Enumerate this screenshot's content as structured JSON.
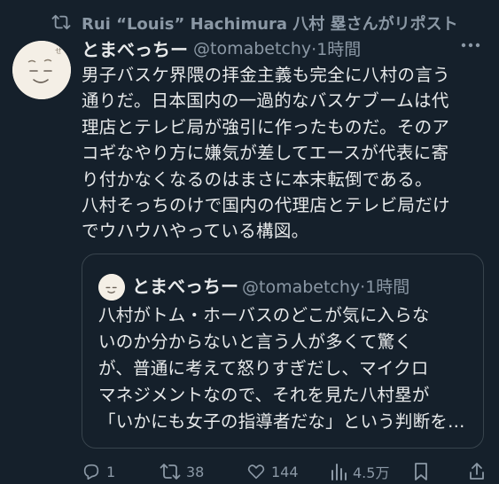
{
  "repost": {
    "text": "Rui “Louis” Hachimura 八村 塁さんがリポスト",
    "icon": "repost-icon"
  },
  "tweet": {
    "display_name": "とまべっちー",
    "handle": "@tomabetchy",
    "time": "·1時間",
    "body": "男子バスケ界隈の拝金主義も完全に八村の言う\n通りだ。日本国内の一過的なバスケブームは代\n理店とテレビ局が強引に作ったものだ。そのア\nコギなやり方に嫌気が差してエースが代表に寄\nり付かなくなるのはまさに本末転倒である。\n八村そっちのけで国内の代理店とテレビ局だけ\nでウハウハやっている構図。"
  },
  "quote": {
    "display_name": "とまべっちー",
    "handle": "@tomabetchy",
    "time": "·1時間",
    "body": "八村がトム・ホーバスのどこが気に入らな\nいのか分からないと言う人が多くて驚く\nが、普通に考えて怒りすぎだし、マイクロ\nマネジメントなので、それを見た八村塁が\n「いかにも女子の指導者だな」という判断を…"
  },
  "actions": {
    "replies": "1",
    "reposts": "38",
    "likes": "144",
    "views": "4.5万",
    "repost_color": "#00ba7c",
    "icons": [
      "reply-icon",
      "repost-icon",
      "like-icon",
      "views-icon",
      "bookmark-icon",
      "share-icon"
    ]
  },
  "colors": {
    "background": "#15202b",
    "text": "#e7e9ea",
    "muted": "#8b98a5",
    "border": "#38444d"
  }
}
